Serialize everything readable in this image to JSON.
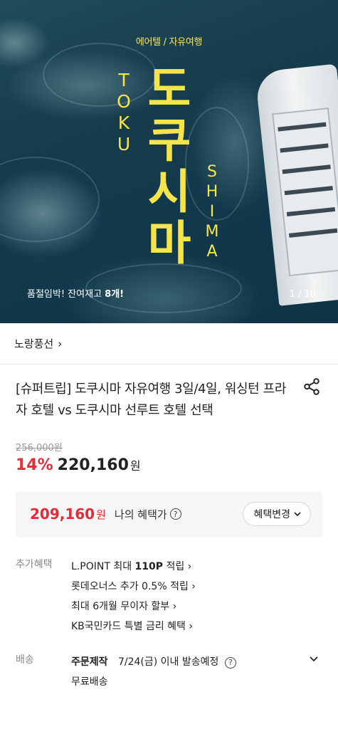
{
  "hero": {
    "tag": "에어텔 / 자유여행",
    "title_chars": [
      "도",
      "쿠",
      "시",
      "마"
    ],
    "latin_left": [
      "T",
      "O",
      "K",
      "U"
    ],
    "latin_right": [
      "S",
      "H",
      "I",
      "M",
      "A"
    ],
    "stock_text": "품절임박! 잔여재고 ",
    "stock_count": "8개!",
    "counter": "1 / 10",
    "accent_color": "#f6e54a"
  },
  "seller": {
    "name": "노랑풍선",
    "chevron": "›"
  },
  "product": {
    "title": "[슈퍼트립] 도쿠시마 자유여행 3일/4일, 워싱턴 프라자 호텔 vs 도쿠시마 선루트 호텔 선택",
    "share_icon": "share-icon",
    "original_price": "256,000원",
    "discount": "14%",
    "price": "220,160",
    "price_unit": "원"
  },
  "benefit": {
    "price": "209,160",
    "unit": "원",
    "label": "나의 혜택가",
    "help": "?",
    "button": "혜택변경",
    "accent_color": "#e22b36"
  },
  "extra_benefits": {
    "label": "추가혜택",
    "items": [
      {
        "pre": "L.POINT 최대 ",
        "bold": "110P",
        "post": " 적립 ›"
      },
      {
        "pre": "롯데오너스 추가 0.5% 적립 ›",
        "bold": "",
        "post": ""
      },
      {
        "pre": "최대 6개월 무이자 할부 ›",
        "bold": "",
        "post": ""
      },
      {
        "pre": "KB국민카드 특별 금리 혜택 ›",
        "bold": "",
        "post": ""
      }
    ]
  },
  "delivery": {
    "label": "배송",
    "type": "주문제작",
    "schedule": "7/24(금) 이내 발송예정",
    "help": "?",
    "fee": "무료배송"
  }
}
